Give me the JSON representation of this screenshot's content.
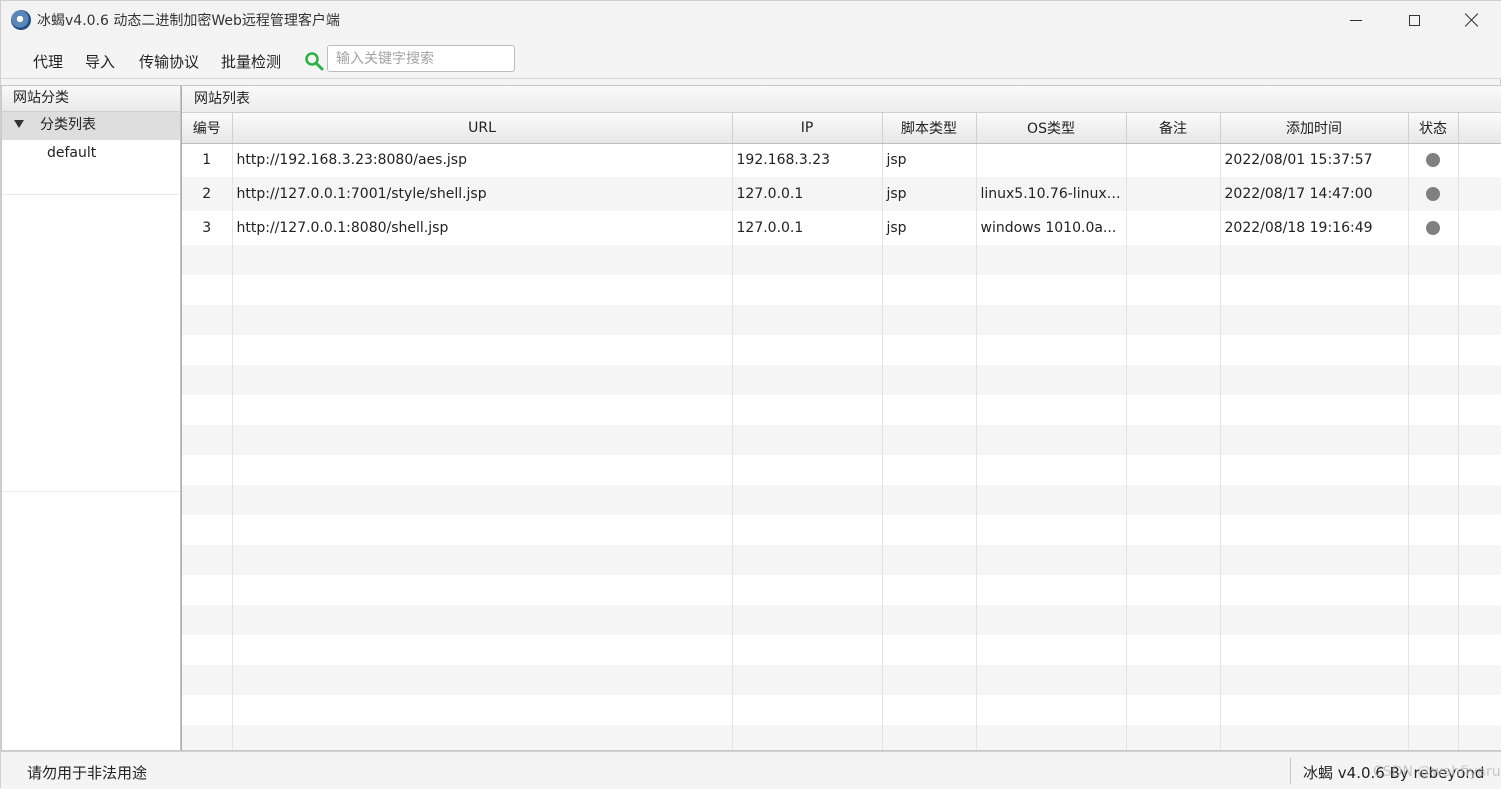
{
  "window": {
    "title": "冰蝎v4.0.6 动态二进制加密Web远程管理客户端"
  },
  "menu": {
    "items": [
      {
        "label": "代理"
      },
      {
        "label": "导入"
      },
      {
        "label": "传输协议"
      },
      {
        "label": "批量检测"
      }
    ],
    "search": {
      "placeholder": "输入关键字搜索",
      "value": "",
      "icon": "search-icon",
      "icon_color": "#2db24a"
    }
  },
  "sidebar": {
    "header": "网站分类",
    "tree": {
      "root": "分类列表",
      "children": [
        {
          "label": "default"
        }
      ]
    }
  },
  "main": {
    "header": "网站列表",
    "columns": [
      "编号",
      "URL",
      "IP",
      "脚本类型",
      "OS类型",
      "备注",
      "添加时间",
      "状态"
    ],
    "rows": [
      {
        "id": "1",
        "url": "http://192.168.3.23:8080/aes.jsp",
        "ip": "192.168.3.23",
        "script": "jsp",
        "os": "",
        "note": "",
        "time": "2022/08/01 15:37:57",
        "status": "gray"
      },
      {
        "id": "2",
        "url": "http://127.0.0.1:7001/style/shell.jsp",
        "ip": "127.0.0.1",
        "script": "jsp",
        "os": "linux5.10.76-linuxk...",
        "note": "",
        "time": "2022/08/17 14:47:00",
        "status": "gray"
      },
      {
        "id": "3",
        "url": "http://127.0.0.1:8080/shell.jsp",
        "ip": "127.0.0.1",
        "script": "jsp",
        "os": "windows 1010.0a...",
        "note": "",
        "time": "2022/08/18 19:16:49",
        "status": "gray"
      }
    ]
  },
  "statusbar": {
    "left": "请勿用于非法用途",
    "right": "冰蝎 v4.0.6    By rebeyond",
    "watermark": "CSDN @wahfiyaru"
  },
  "colors": {
    "status_dot": "#808080",
    "search_icon": "#2db24a"
  }
}
